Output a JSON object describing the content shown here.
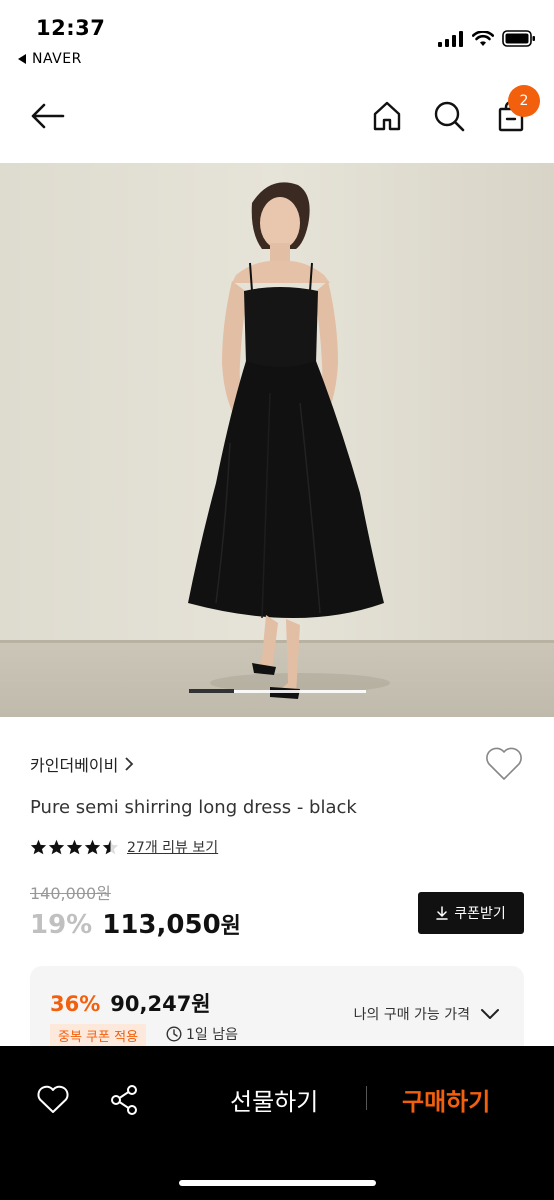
{
  "status_bar": {
    "time": "12:37",
    "back_app": "NAVER"
  },
  "header": {
    "cart_count": "2"
  },
  "product": {
    "brand": "카인더베이비",
    "name": "Pure semi shirring long dress - black",
    "rating": 4.5,
    "review_link": "27개 리뷰 보기",
    "original_price": "140,000원",
    "discount": "19%",
    "sale_price": "113,050",
    "currency": "원",
    "coupon_button": "쿠폰받기"
  },
  "best_price": {
    "discount": "36%",
    "price": "90,247원",
    "coupon_tag": "중복 쿠폰 적용",
    "time_left": "1일 남음",
    "my_price_label": "나의 구매 가능 가격"
  },
  "bottom_bar": {
    "gift": "선물하기",
    "buy": "구매하기"
  },
  "colors": {
    "accent": "#f2600e",
    "dark": "#000000"
  },
  "carousel": {
    "current": 1
  }
}
